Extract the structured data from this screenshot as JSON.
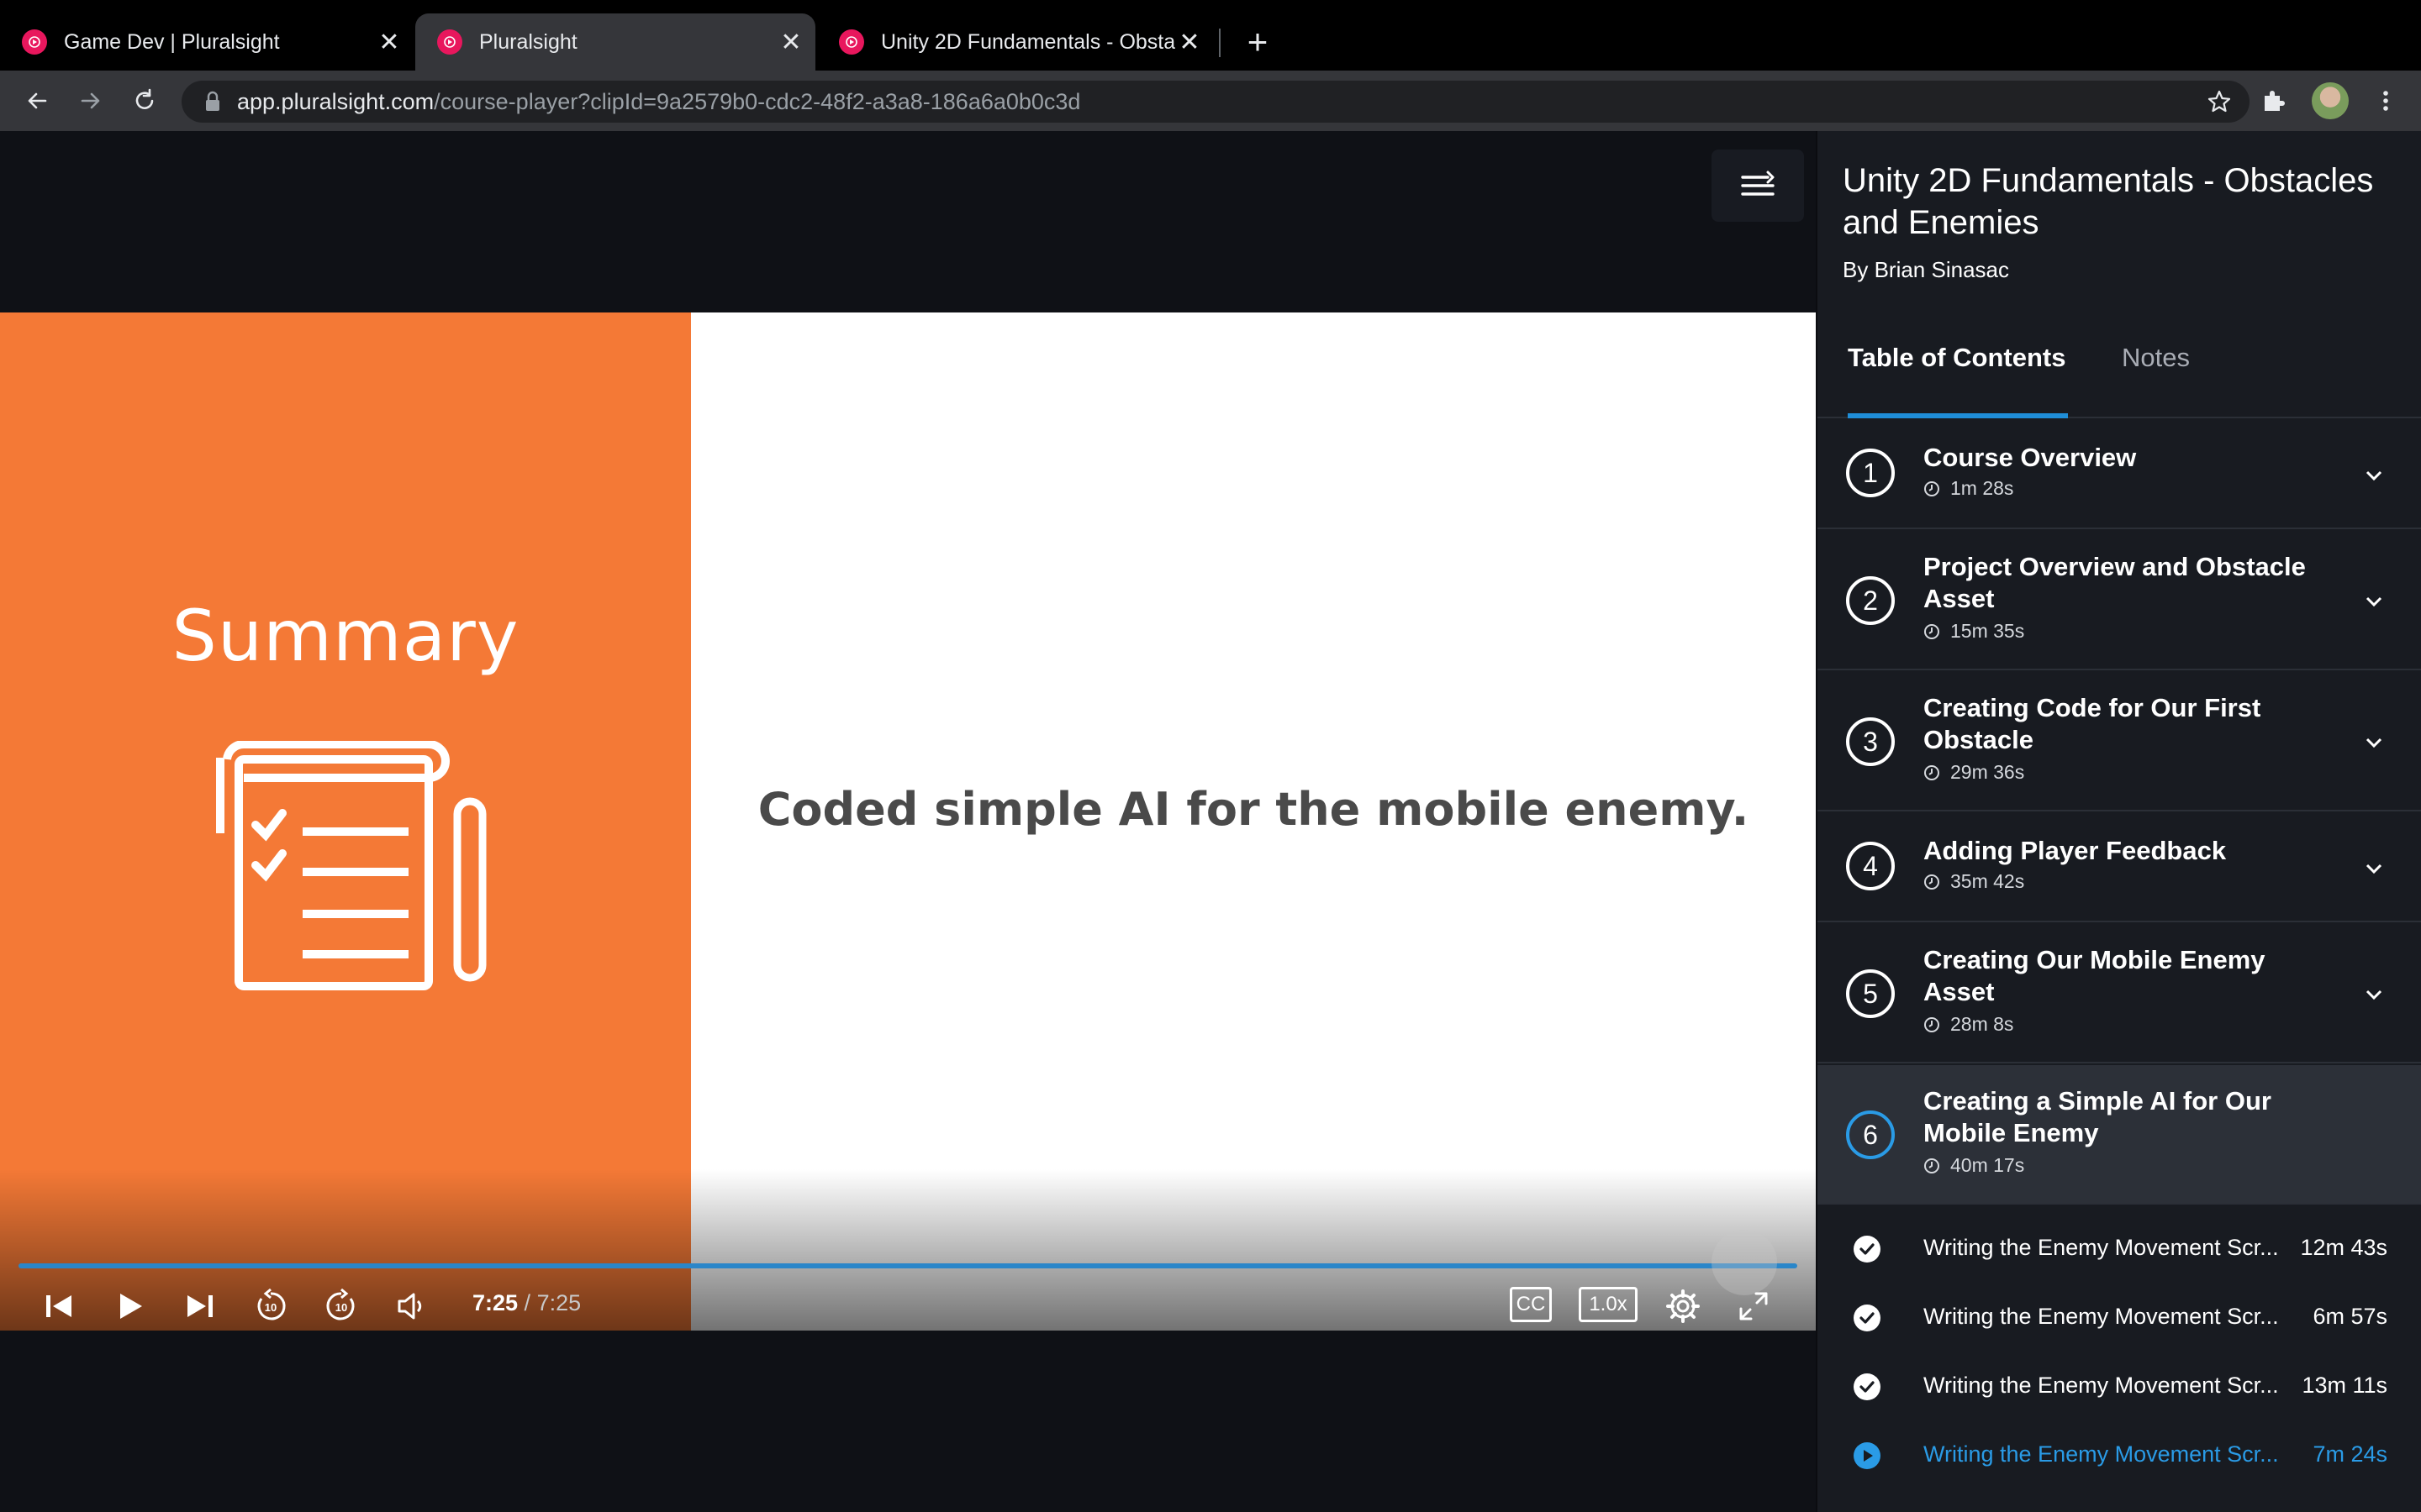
{
  "browser": {
    "tabs": [
      {
        "title": "Game Dev | Pluralsight",
        "close": "✕"
      },
      {
        "title": "Pluralsight",
        "close": "✕"
      },
      {
        "title": "Unity 2D Fundamentals - Obsta",
        "close": "✕"
      }
    ],
    "new_tab": "+",
    "url_domain": "app.pluralsight.com",
    "url_path": "/course-player?clipId=9a2579b0-cdc2-48f2-a3a8-186a6a0b0c3d"
  },
  "player": {
    "slide_title": "Summary",
    "slide_text": "Coded simple AI for the mobile enemy.",
    "current_time": "7:25",
    "time_sep": " / ",
    "total_time": "7:25",
    "progress": 1.0,
    "cc_label": "CC",
    "speed_label": "1.0x"
  },
  "sidebar": {
    "course_title": "Unity 2D Fundamentals - Obstacles and Enemies",
    "author": "By Brian Sinasac",
    "tabs": [
      "Table of Contents",
      "Notes"
    ],
    "modules": [
      {
        "num": "1",
        "title": "Course Overview",
        "duration": "1m 28s"
      },
      {
        "num": "2",
        "title": "Project Overview and Obstacle Asset",
        "duration": "15m 35s"
      },
      {
        "num": "3",
        "title": "Creating Code for Our First Obstacle",
        "duration": "29m 36s"
      },
      {
        "num": "4",
        "title": "Adding Player Feedback",
        "duration": "35m 42s"
      },
      {
        "num": "5",
        "title": "Creating Our Mobile Enemy Asset",
        "duration": "28m 8s"
      },
      {
        "num": "6",
        "title": "Creating a Simple AI for Our Mobile Enemy",
        "duration": "40m 17s"
      }
    ],
    "clips": [
      {
        "title": "Writing the Enemy Movement Scr...",
        "duration": "12m 43s",
        "status": "completed"
      },
      {
        "title": "Writing the Enemy Movement Scr...",
        "duration": "6m 57s",
        "status": "completed"
      },
      {
        "title": "Writing the Enemy Movement Scr...",
        "duration": "13m 11s",
        "status": "completed"
      },
      {
        "title": "Writing the Enemy Movement Scr...",
        "duration": "7m 24s",
        "status": "current"
      }
    ]
  },
  "colors": {
    "accent": "#2a9be6",
    "slide_orange": "#f47936",
    "brand_pink": "#e8175d"
  }
}
